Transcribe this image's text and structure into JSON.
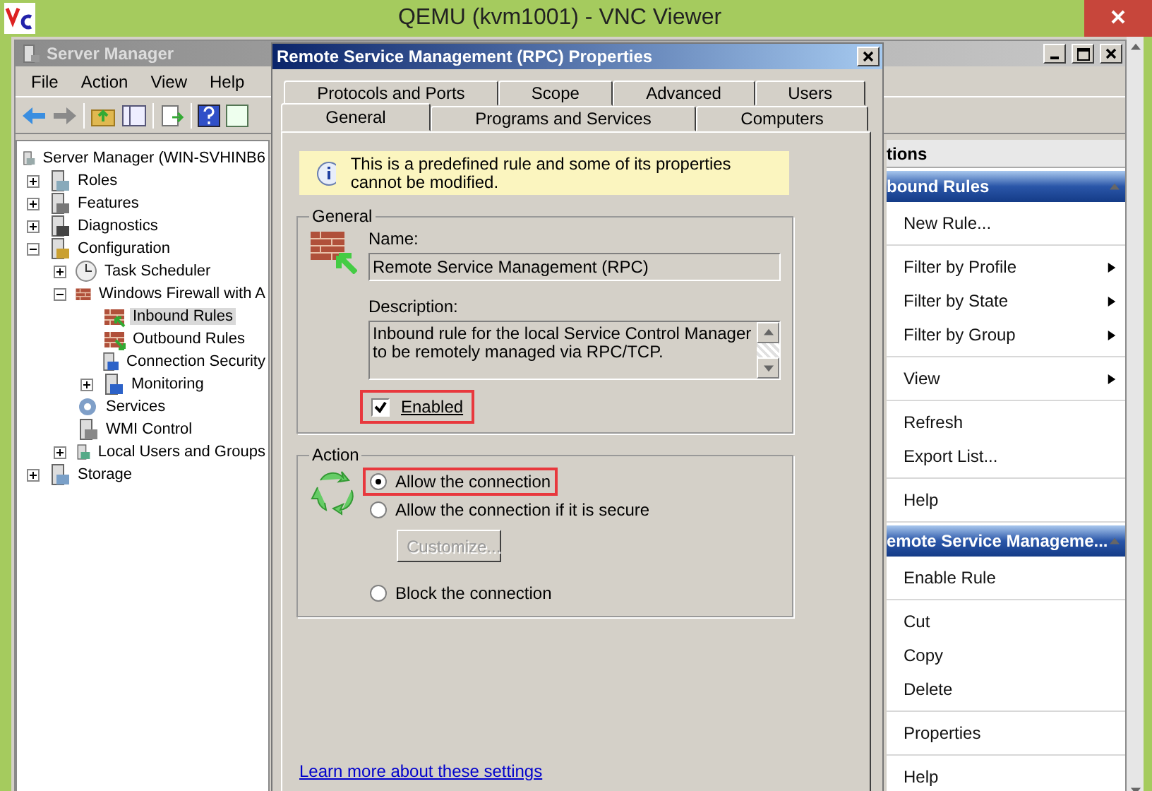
{
  "vnc_window": {
    "title": "QEMU (kvm1001) - VNC Viewer"
  },
  "server_manager": {
    "title": "Server Manager",
    "menu": [
      "File",
      "Action",
      "View",
      "Help"
    ],
    "tree": [
      {
        "label": "Server Manager (WIN-SVHINB6",
        "kind": "server",
        "selected": false,
        "children": [
          {
            "label": "Roles",
            "kind": "roles",
            "selected": false,
            "expanded": false
          },
          {
            "label": "Features",
            "kind": "features",
            "selected": false,
            "expanded": false
          },
          {
            "label": "Diagnostics",
            "kind": "diagnostics",
            "selected": false,
            "expanded": false
          },
          {
            "label": "Configuration",
            "kind": "configuration",
            "selected": false,
            "expanded": true,
            "children": [
              {
                "label": "Task Scheduler",
                "kind": "clock",
                "selected": false,
                "expanded": false
              },
              {
                "label": "Windows Firewall with A",
                "kind": "firewall",
                "selected": false,
                "expanded": true,
                "children": [
                  {
                    "label": "Inbound Rules",
                    "kind": "rules_in",
                    "selected": true
                  },
                  {
                    "label": "Outbound Rules",
                    "kind": "rules_out",
                    "selected": false
                  },
                  {
                    "label": "Connection Security",
                    "kind": "security",
                    "selected": false
                  },
                  {
                    "label": "Monitoring",
                    "kind": "monitor",
                    "selected": false,
                    "expanded": false
                  }
                ]
              },
              {
                "label": "Services",
                "kind": "services",
                "selected": false
              },
              {
                "label": "WMI Control",
                "kind": "wmi",
                "selected": false
              },
              {
                "label": "Local Users and Groups",
                "kind": "users",
                "selected": false,
                "expanded": false
              }
            ]
          },
          {
            "label": "Storage",
            "kind": "storage",
            "selected": false,
            "expanded": false
          }
        ]
      }
    ],
    "actions": {
      "header": "tions",
      "sections": [
        {
          "title": "bound Rules",
          "groups": [
            [
              {
                "label": "New Rule...",
                "submenu": false
              }
            ],
            [
              {
                "label": "Filter by Profile",
                "submenu": true
              },
              {
                "label": "Filter by State",
                "submenu": true
              },
              {
                "label": "Filter by Group",
                "submenu": true
              }
            ],
            [
              {
                "label": "View",
                "submenu": true
              }
            ],
            [
              {
                "label": "Refresh",
                "submenu": false
              },
              {
                "label": "Export List...",
                "submenu": false
              }
            ],
            [
              {
                "label": "Help",
                "submenu": false
              }
            ]
          ]
        },
        {
          "title": "emote Service Manageme...",
          "groups": [
            [
              {
                "label": "Enable Rule",
                "submenu": false
              }
            ],
            [
              {
                "label": "Cut",
                "submenu": false
              },
              {
                "label": "Copy",
                "submenu": false
              },
              {
                "label": "Delete",
                "submenu": false
              }
            ],
            [
              {
                "label": "Properties",
                "submenu": false
              }
            ],
            [
              {
                "label": "Help",
                "submenu": false
              }
            ]
          ]
        }
      ]
    }
  },
  "dialog": {
    "title": "Remote Service Management (RPC) Properties",
    "tab_rows": [
      [
        {
          "label": "Protocols and Ports",
          "selected": false
        },
        {
          "label": "Scope",
          "selected": false
        },
        {
          "label": "Advanced",
          "selected": false
        },
        {
          "label": "Users",
          "selected": false
        }
      ],
      [
        {
          "label": "General",
          "selected": true
        },
        {
          "label": "Programs and Services",
          "selected": false
        },
        {
          "label": "Computers",
          "selected": false
        }
      ]
    ],
    "info": "This is a predefined rule and some of its properties cannot be modified.",
    "general": {
      "legend": "General",
      "name_label": "Name:",
      "name_value": "Remote Service Management (RPC)",
      "description_label": "Description:",
      "description_value": "Inbound rule for the local Service Control Manager to be remotely managed via RPC/TCP.",
      "enabled": {
        "label": "Enabled",
        "checked": true,
        "highlighted": true
      }
    },
    "action": {
      "legend": "Action",
      "options": [
        {
          "label": "Allow the connection",
          "selected": true,
          "highlighted": true
        },
        {
          "label": "Allow the connection if it is secure",
          "selected": false,
          "highlighted": false,
          "button": {
            "label": "Customize...",
            "disabled": true
          }
        },
        {
          "label": "Block the connection",
          "selected": false,
          "highlighted": false
        }
      ]
    },
    "link": "Learn more about these settings"
  }
}
